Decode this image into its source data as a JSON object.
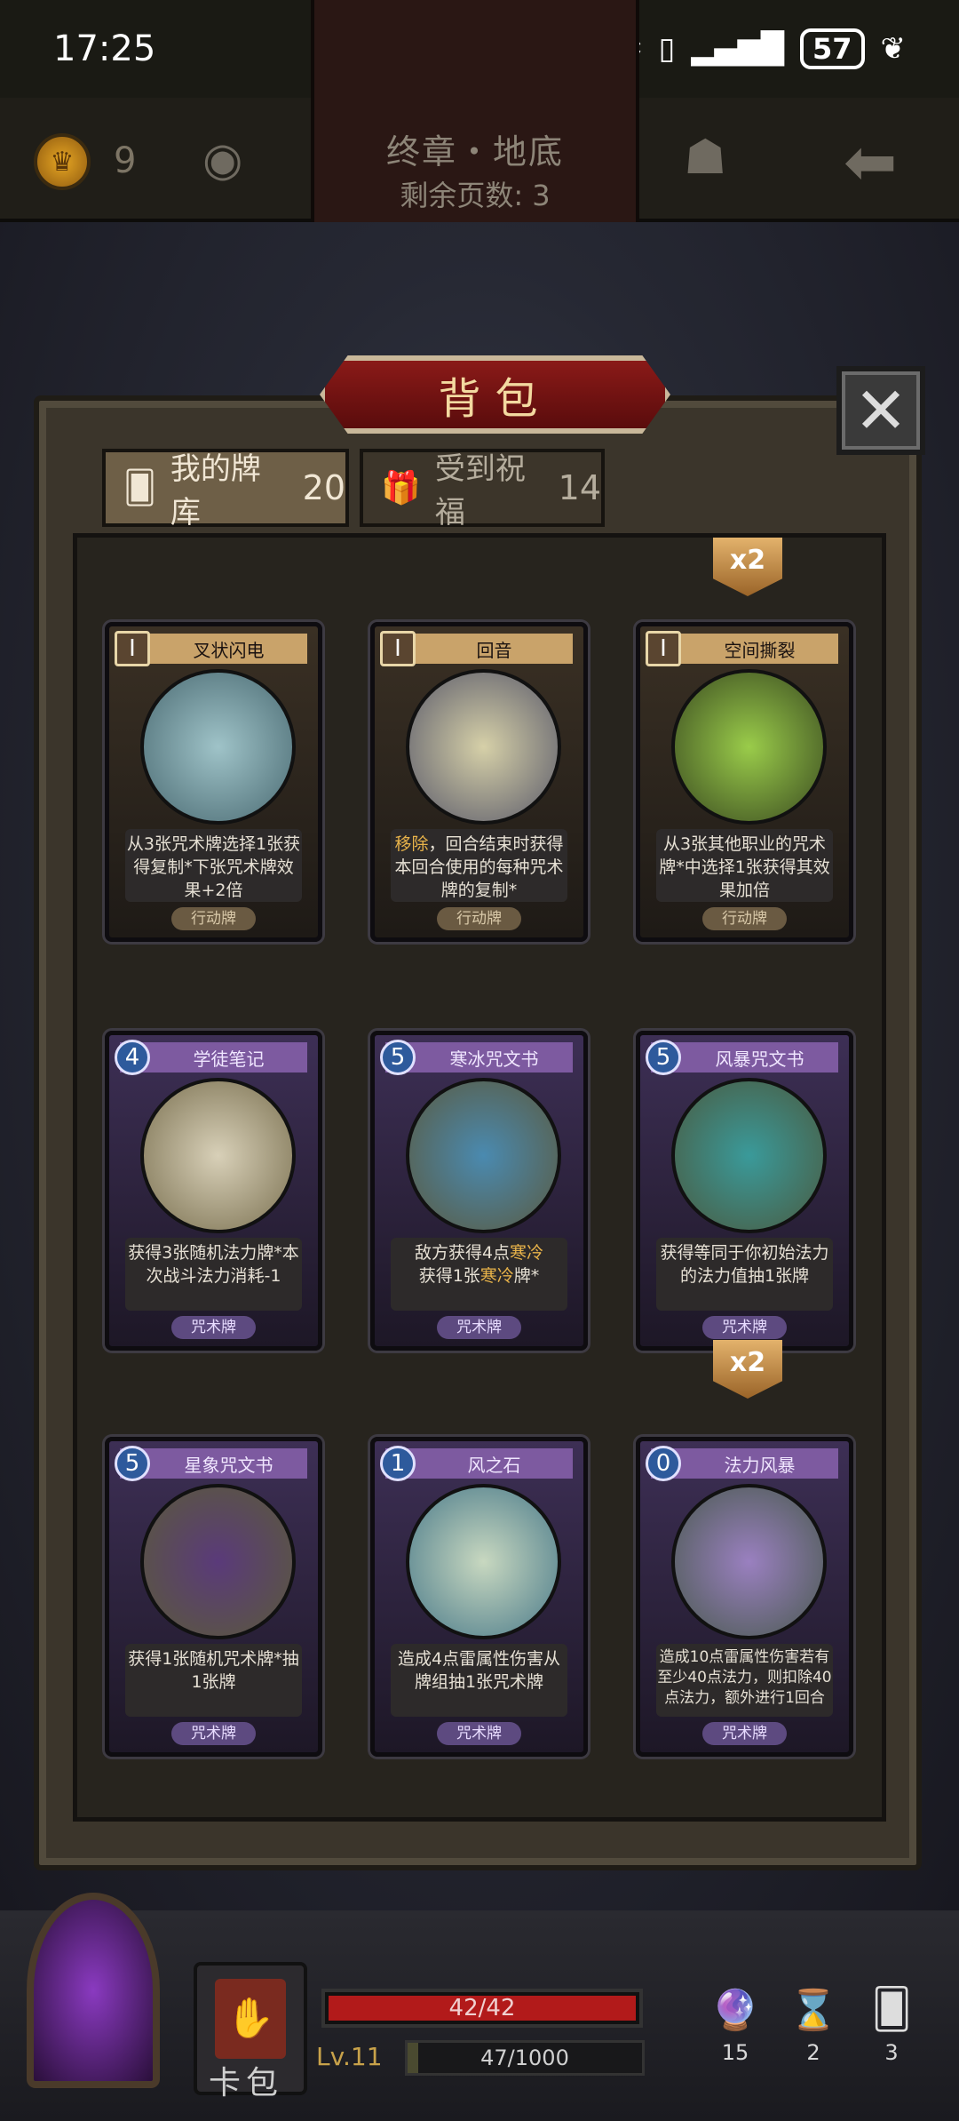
{
  "status_bar": {
    "time": "17:25",
    "battery": "57"
  },
  "header": {
    "coins": "9",
    "chapter": "终章・地底",
    "pages_left": "剩余页数: 3"
  },
  "bag": {
    "title": "背包",
    "close": "✕"
  },
  "tabs": [
    {
      "label": "我的牌库",
      "count": "20"
    },
    {
      "label": "受到祝福",
      "count": "14"
    }
  ],
  "cards": [
    {
      "name": "叉状闪电",
      "cost": "I",
      "type": "行动牌",
      "desc": "从3张咒术牌选择1张获得复制*下张咒术牌效果+2倍",
      "art_color": "#5c8fa0"
    },
    {
      "name": "回音",
      "cost": "I",
      "type": "行动牌",
      "desc": "",
      "art_color": "#6f7a8c",
      "desc_parts": [
        "移除",
        "，回合结束时获得本回合使用的每种咒术牌的复制*"
      ]
    },
    {
      "name": "空间撕裂",
      "cost": "I",
      "type": "行动牌",
      "desc": "从3张其他职业的咒术牌*中选择1张获得其效果加倍",
      "art_color": "#6a7f3c"
    },
    {
      "name": "学徒笔记",
      "cost": "4",
      "type": "咒术牌",
      "desc": "获得3张随机法力牌*本次战斗法力消耗-1",
      "art_color": "#a8a070"
    },
    {
      "name": "寒冰咒文书",
      "cost": "5",
      "type": "咒术牌",
      "desc": "",
      "art_color": "#8f9a70",
      "desc_parts": [
        "敌方获得4点",
        "寒冷",
        "获得1张",
        "寒冷",
        "牌*"
      ]
    },
    {
      "name": "风暴咒文书",
      "cost": "5",
      "type": "咒术牌",
      "desc": "获得等同于你初始法力的法力值抽1张牌",
      "art_color": "#6a8a7a"
    },
    {
      "name": "星象咒文书",
      "cost": "5",
      "type": "咒术牌",
      "desc": "获得1张随机咒术牌*抽1张牌",
      "art_color": "#8c8a60"
    },
    {
      "name": "风之石",
      "cost": "1",
      "type": "咒术牌",
      "desc": "造成4点雷属性伤害从牌组抽1张咒术牌",
      "art_color": "#8a9a80"
    },
    {
      "name": "法力风暴",
      "cost": "0",
      "type": "咒术牌",
      "desc": "造成10点雷属性伤害若有至少40点法力，则扣除40点法力，额外进行1回合",
      "art_color": "#8a9070"
    }
  ],
  "badges": [
    "x2",
    "x2"
  ],
  "bottom": {
    "deck_label": "卡包",
    "hp": "42/42",
    "hp_fraction": 1.0,
    "level": "Lv.11",
    "xp": "47/1000",
    "xp_fraction": 0.047,
    "resources": [
      {
        "icon": "🔮",
        "value": "15"
      },
      {
        "icon": "⌛",
        "value": "2"
      },
      {
        "icon": "🂠",
        "value": "3"
      }
    ]
  }
}
